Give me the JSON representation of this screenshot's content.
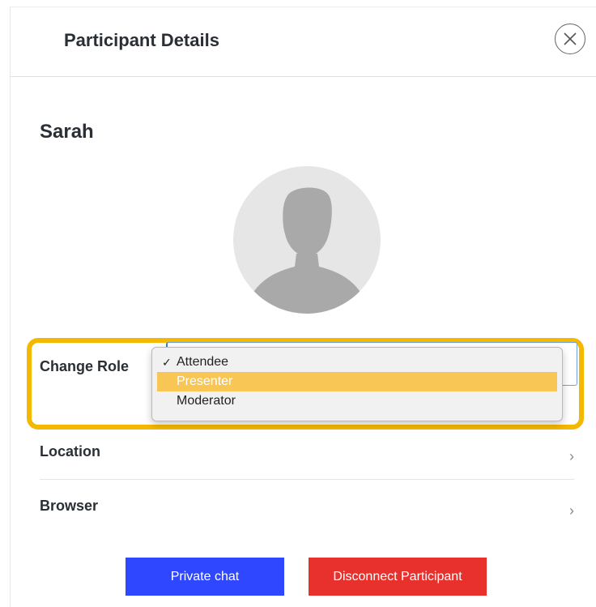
{
  "header": {
    "title": "Participant Details",
    "close_icon": "close-icon"
  },
  "participant": {
    "name": "Sarah",
    "avatar_icon": "user-silhouette-icon"
  },
  "role": {
    "label": "Change Role",
    "options": [
      {
        "label": "Attendee",
        "checked": true
      },
      {
        "label": "Presenter",
        "highlighted": true
      },
      {
        "label": "Moderator"
      }
    ]
  },
  "details": [
    {
      "label": "Location",
      "chevron": "›"
    },
    {
      "label": "Browser",
      "chevron": "›"
    }
  ],
  "actions": {
    "private_chat": "Private chat",
    "disconnect": "Disconnect Participant"
  },
  "colors": {
    "highlight_border": "#f5b800",
    "option_highlight": "#f7c654",
    "private_chat_bg": "#2f47ff",
    "disconnect_bg": "#e8312c"
  }
}
